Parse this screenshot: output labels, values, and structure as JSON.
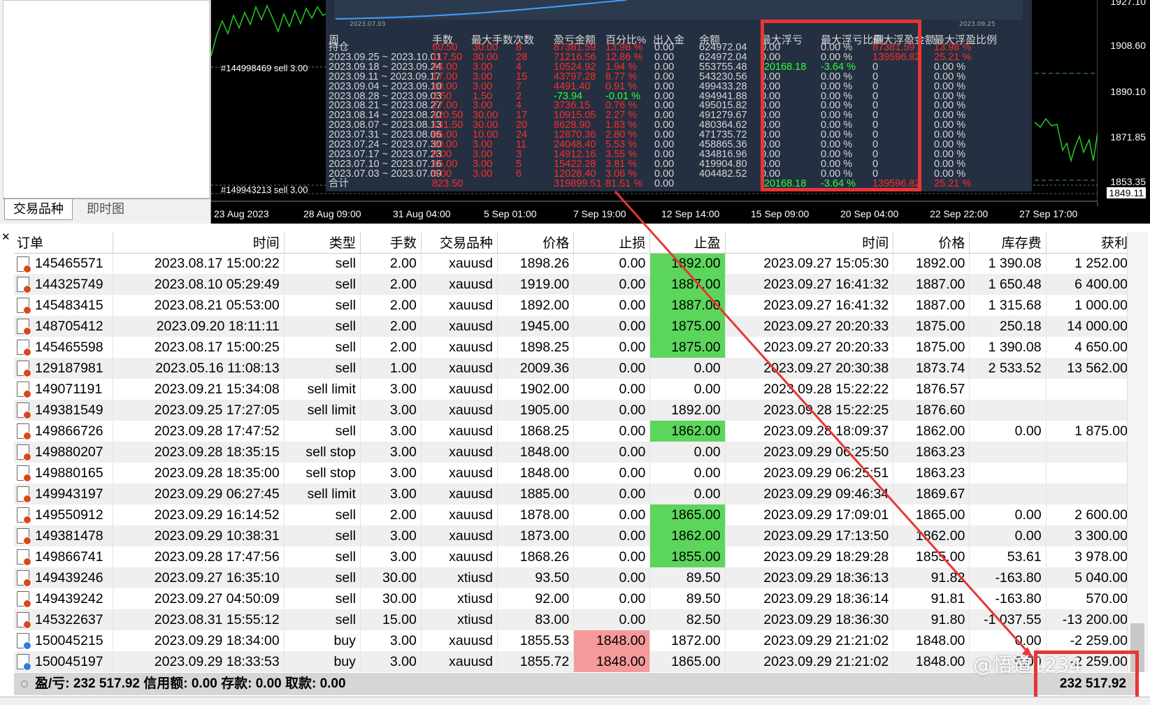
{
  "left_tabs": [
    "交易品种",
    "即时图"
  ],
  "chart": {
    "price_labels": [
      "1927.10",
      "1908.60",
      "1890.10",
      "1871.85",
      "1853.35"
    ],
    "current_price": "1849.11",
    "date_labels": [
      "23 Aug 2023",
      "28 Aug 09:00",
      "31 Aug 04:00",
      "5 Sep 01:00",
      "7 Sep 19:00",
      "12 Sep 14:00",
      "15 Sep 09:00",
      "20 Sep 04:00",
      "22 Sep 22:00",
      "27 Sep 17:00"
    ],
    "order_labels": [
      "#144998469 sell 3.00",
      "#149943213 sell 3.00"
    ],
    "inner_dates": [
      "2023.07.03",
      "2023.09.25"
    ]
  },
  "stats": {
    "headers": [
      "周",
      "手数",
      "最大手数",
      "次数",
      "盈亏金额",
      "百分比%",
      "出入金",
      "余额",
      "最大浮亏",
      "最大浮亏比例",
      "最大浮盈金额",
      "最大浮盈比例"
    ],
    "weeks": [
      "持仓",
      "2023.09.25 ~ 2023.10.01",
      "2023.09.18 ~ 2023.09.24",
      "2023.09.11 ~ 2023.09.17",
      "2023.09.04 ~ 2023.09.10",
      "2023.08.28 ~ 2023.09.03",
      "2023.08.21 ~ 2023.08.27",
      "2023.08.14 ~ 2023.08.20",
      "2023.08.07 ~ 2023.08.13",
      "2023.07.31 ~ 2023.08.06",
      "2023.07.24 ~ 2023.07.30",
      "2023.07.17 ~ 2023.07.23",
      "2023.07.10 ~ 2023.07.16",
      "2023.07.03 ~ 2023.07.09",
      "合计"
    ],
    "lots": [
      "60.50",
      "117.50",
      "24.00",
      "17.00",
      "10.00",
      "2.50",
      "27.00",
      "120.50",
      "131.50",
      "66.00",
      "30.00",
      "9.00",
      "16.00",
      "9.00",
      "823.50"
    ],
    "max_lots": [
      "30.00",
      "30.00",
      "3.00",
      "3.00",
      "3.00",
      "1.50",
      "3.00",
      "30.00",
      "30.00",
      "10.00",
      "3.00",
      "3.00",
      "3.00",
      "3.00",
      ""
    ],
    "counts": [
      "8",
      "28",
      "4",
      "15",
      "7",
      "2",
      "4",
      "17",
      "20",
      "24",
      "11",
      "3",
      "5",
      "6",
      ""
    ],
    "pnl": [
      "87381.59",
      "71216.56",
      "10524.92",
      "43797.28",
      "4491.40",
      "-73.94",
      "3736.15",
      "10915.05",
      "8628.90",
      "12870.36",
      "24048.40",
      "14912.16",
      "15422.28",
      "12028.40",
      "319899.51"
    ],
    "pct": [
      "13.98 %",
      "12.86 %",
      "1.94 %",
      "8.77 %",
      "0.91 %",
      "-0.01 %",
      "0.76 %",
      "2.27 %",
      "1.83 %",
      "2.80 %",
      "5.53 %",
      "3.55 %",
      "3.81 %",
      "3.06 %",
      "81.51 %"
    ],
    "deposit": [
      "0.00",
      "0.00",
      "0.00",
      "0.00",
      "0.00",
      "0.00",
      "0.00",
      "0.00",
      "0.00",
      "0.00",
      "0.00",
      "0.00",
      "0.00",
      "0.00",
      "0.00"
    ],
    "balance": [
      "624972.04",
      "624972.04",
      "553755.48",
      "543230.56",
      "499433.28",
      "494941.88",
      "495015.82",
      "491279.67",
      "480364.62",
      "471735.72",
      "458865.36",
      "434816.96",
      "419904.80",
      "404482.52",
      ""
    ],
    "max_float_loss": [
      "0.00",
      "0.00",
      "-20168.18",
      "0.00",
      "0.00",
      "0.00",
      "0.00",
      "0.00",
      "0.00",
      "0.00",
      "0.00",
      "0.00",
      "0.00",
      "0.00",
      "-20168.18"
    ],
    "max_float_loss_pct": [
      "0.00 %",
      "0.00 %",
      "-3.64 %",
      "0.00 %",
      "0.00 %",
      "0.00 %",
      "0.00 %",
      "0.00 %",
      "0.00 %",
      "0.00 %",
      "0.00 %",
      "0.00 %",
      "0.00 %",
      "0.00 %",
      "-3.64 %"
    ],
    "max_float_profit": [
      "87381.59",
      "139596.82",
      "0",
      "0",
      "0",
      "0",
      "0",
      "0",
      "0",
      "0",
      "0",
      "0",
      "0",
      "0",
      "139596.82"
    ],
    "max_float_profit_pct": [
      "13.98 %",
      "25.21 %",
      "0.00 %",
      "0.00 %",
      "0.00 %",
      "0.00 %",
      "0.00 %",
      "0.00 %",
      "0.00 %",
      "0.00 %",
      "0.00 %",
      "0.00 %",
      "0.00 %",
      "0.00 %",
      "25.21 %"
    ]
  },
  "table": {
    "headers": [
      "订单",
      "时间",
      "类型",
      "手数",
      "交易品种",
      "价格",
      "止损",
      "止盈",
      "时间",
      "价格",
      "库存费",
      "获利"
    ],
    "rows": [
      [
        "145465571",
        "2023.08.17 15:00:22",
        "sell",
        "2.00",
        "xauusd",
        "1898.26",
        "0.00",
        "1892.00",
        "2023.09.27 15:05:30",
        "1892.00",
        "1 390.08",
        "1 252.00"
      ],
      [
        "144325749",
        "2023.08.10 05:29:49",
        "sell",
        "2.00",
        "xauusd",
        "1919.00",
        "0.00",
        "1887.00",
        "2023.09.27 16:41:32",
        "1887.00",
        "1 650.48",
        "6 400.00"
      ],
      [
        "145483415",
        "2023.08.21 05:53:00",
        "sell",
        "2.00",
        "xauusd",
        "1892.00",
        "0.00",
        "1887.00",
        "2023.09.27 16:41:32",
        "1887.00",
        "1 315.68",
        "1 000.00"
      ],
      [
        "148705412",
        "2023.09.20 18:11:11",
        "sell",
        "2.00",
        "xauusd",
        "1945.00",
        "0.00",
        "1875.00",
        "2023.09.27 20:20:33",
        "1875.00",
        "250.18",
        "14 000.00"
      ],
      [
        "145465598",
        "2023.08.17 15:00:25",
        "sell",
        "2.00",
        "xauusd",
        "1898.25",
        "0.00",
        "1875.00",
        "2023.09.27 20:20:33",
        "1875.00",
        "1 390.08",
        "4 650.00"
      ],
      [
        "129187981",
        "2023.05.16 11:08:13",
        "sell",
        "1.00",
        "xauusd",
        "2009.36",
        "0.00",
        "0.00",
        "2023.09.27 20:30:38",
        "1873.74",
        "2 533.52",
        "13 562.00"
      ],
      [
        "149071191",
        "2023.09.21 15:34:08",
        "sell limit",
        "3.00",
        "xauusd",
        "1902.00",
        "0.00",
        "0.00",
        "2023.09.28 15:22:22",
        "1876.57",
        "",
        ""
      ],
      [
        "149381549",
        "2023.09.25 17:27:05",
        "sell limit",
        "3.00",
        "xauusd",
        "1905.00",
        "0.00",
        "1892.00",
        "2023.09.28 15:22:25",
        "1876.60",
        "",
        ""
      ],
      [
        "149866726",
        "2023.09.28 17:47:52",
        "sell",
        "3.00",
        "xauusd",
        "1868.25",
        "0.00",
        "1862.00",
        "2023.09.28 18:09:37",
        "1862.00",
        "0.00",
        "1 875.00"
      ],
      [
        "149880207",
        "2023.09.28 18:35:15",
        "sell stop",
        "3.00",
        "xauusd",
        "1848.00",
        "0.00",
        "0.00",
        "2023.09.29 06:25:50",
        "1863.23",
        "",
        ""
      ],
      [
        "149880165",
        "2023.09.28 18:35:00",
        "sell stop",
        "3.00",
        "xauusd",
        "1848.00",
        "0.00",
        "0.00",
        "2023.09.29 06:25:51",
        "1863.23",
        "",
        ""
      ],
      [
        "149943197",
        "2023.09.29 06:27:45",
        "sell limit",
        "3.00",
        "xauusd",
        "1885.00",
        "0.00",
        "0.00",
        "2023.09.29 09:46:34",
        "1869.67",
        "",
        ""
      ],
      [
        "149550912",
        "2023.09.29 16:14:52",
        "sell",
        "2.00",
        "xauusd",
        "1878.00",
        "0.00",
        "1865.00",
        "2023.09.29 17:09:01",
        "1865.00",
        "0.00",
        "2 600.00"
      ],
      [
        "149381478",
        "2023.09.29 10:38:31",
        "sell",
        "3.00",
        "xauusd",
        "1873.00",
        "0.00",
        "1862.00",
        "2023.09.29 17:13:50",
        "1862.00",
        "0.00",
        "3 300.00"
      ],
      [
        "149866741",
        "2023.09.28 17:47:56",
        "sell",
        "3.00",
        "xauusd",
        "1868.26",
        "0.00",
        "1855.00",
        "2023.09.29 18:29:28",
        "1855.00",
        "53.61",
        "3 978.00"
      ],
      [
        "149439246",
        "2023.09.27 16:35:10",
        "sell",
        "30.00",
        "xtiusd",
        "93.50",
        "0.00",
        "89.50",
        "2023.09.29 18:36:13",
        "91.82",
        "-163.80",
        "5 040.00"
      ],
      [
        "149439242",
        "2023.09.27 04:50:09",
        "sell",
        "30.00",
        "xtiusd",
        "92.00",
        "0.00",
        "89.50",
        "2023.09.29 18:36:14",
        "91.81",
        "-163.80",
        "570.00"
      ],
      [
        "145322637",
        "2023.08.31 15:55:12",
        "sell",
        "15.00",
        "xtiusd",
        "83.00",
        "0.00",
        "82.50",
        "2023.09.29 18:36:30",
        "91.80",
        "-1 037.55",
        "-13 200.00"
      ],
      [
        "150045215",
        "2023.09.29 18:34:00",
        "buy",
        "3.00",
        "xauusd",
        "1855.53",
        "1848.00",
        "1872.00",
        "2023.09.29 21:21:02",
        "1848.00",
        "0.00",
        "-2 259.00"
      ],
      [
        "150045197",
        "2023.09.29 18:33:53",
        "buy",
        "3.00",
        "xauusd",
        "1855.72",
        "1848.00",
        "1865.00",
        "2023.09.29 21:21:02",
        "1848.00",
        "0.00",
        "-2 259.00"
      ]
    ],
    "tp_highlight_rows": [
      0,
      1,
      2,
      3,
      4,
      8,
      12,
      13,
      14
    ],
    "sl_highlight_rows": [
      18,
      19
    ]
  },
  "footer": {
    "summary": "盈/亏: 232 517.92  信用额: 0.00  存款: 0.00  取款: 0.00",
    "total": "232 517.92"
  },
  "watermark": "@悟道1234"
}
